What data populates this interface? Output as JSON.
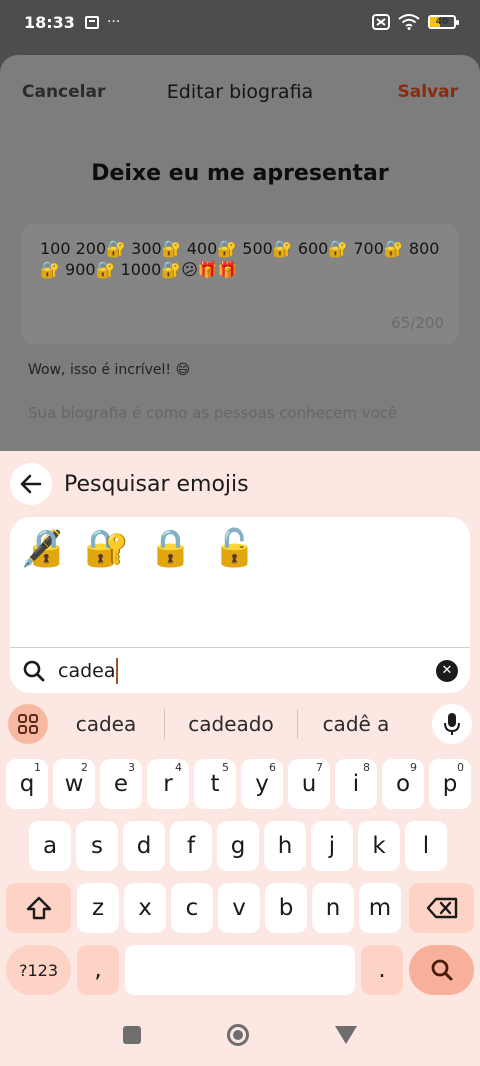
{
  "status_bar": {
    "time": "18:33",
    "notification_icon": "notification-box-icon",
    "more": "···",
    "battery_level": "40",
    "battery_fraction": 0.4,
    "battery_color": "#f1c40f"
  },
  "sheet": {
    "cancel_label": "Cancelar",
    "title": "Editar biografia",
    "save_label": "Salvar",
    "save_color": "#8a2a0e",
    "heading": "Deixe eu me apresentar",
    "bio_text": "100 200🔐 300🔐 400🔐 500🔐 600🔐 700🔐 800 🔐 900🔐 1000🔐😕🎁🎁",
    "bio_counter": "65/200",
    "hint_wow": "Wow, isso é incrível! 😄",
    "hint_bio": "Sua biografia é como as pessoas conhecem você"
  },
  "emoji_search": {
    "title": "Pesquisar emojis",
    "back_icon": "arrow-left-icon",
    "results": [
      "🔏",
      "🔐",
      "🔒",
      "🔓"
    ],
    "query": "cadea",
    "clear_icon": "clear-x-icon"
  },
  "suggestions": {
    "items": [
      "cadea",
      "cadeado",
      "cadê a"
    ],
    "apps_icon": "grid-apps-icon",
    "mic_icon": "microphone-icon"
  },
  "keyboard": {
    "row1": [
      {
        "key": "q",
        "num": "1"
      },
      {
        "key": "w",
        "num": "2"
      },
      {
        "key": "e",
        "num": "3"
      },
      {
        "key": "r",
        "num": "4"
      },
      {
        "key": "t",
        "num": "5"
      },
      {
        "key": "y",
        "num": "6"
      },
      {
        "key": "u",
        "num": "7"
      },
      {
        "key": "i",
        "num": "8"
      },
      {
        "key": "o",
        "num": "9"
      },
      {
        "key": "p",
        "num": "0"
      }
    ],
    "row2": [
      "a",
      "s",
      "d",
      "f",
      "g",
      "h",
      "j",
      "k",
      "l"
    ],
    "row3": [
      "z",
      "x",
      "c",
      "v",
      "b",
      "n",
      "m"
    ],
    "symbols_label": "?123",
    "comma": ",",
    "period": ".",
    "accent_color": "#f8b09a"
  }
}
